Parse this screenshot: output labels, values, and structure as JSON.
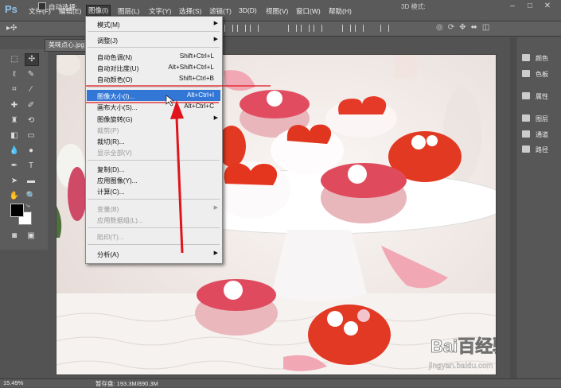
{
  "app": {
    "logo": "Ps"
  },
  "menubar": {
    "items": [
      "文件(F)",
      "编辑(E)",
      "图像(I)",
      "图层(L)",
      "文字(Y)",
      "选择(S)",
      "滤镜(T)",
      "3D(D)",
      "视图(V)",
      "窗口(W)",
      "帮助(H)"
    ],
    "controls": [
      "–",
      "□",
      "✕"
    ]
  },
  "options_bar": {
    "auto_select_label": "自动选择:",
    "mode_3d_label": "3D 模式:"
  },
  "document": {
    "tab_title": "美味点心.jpg"
  },
  "image_menu": {
    "items": [
      {
        "label": "模式(M)",
        "shortcut": "",
        "submenu": true,
        "disabled": false
      },
      {
        "label": "调整(J)",
        "shortcut": "",
        "submenu": true,
        "disabled": false
      },
      {
        "label": "自动色调(N)",
        "shortcut": "Shift+Ctrl+L",
        "submenu": false,
        "disabled": false
      },
      {
        "label": "自动对比度(U)",
        "shortcut": "Alt+Shift+Ctrl+L",
        "submenu": false,
        "disabled": false
      },
      {
        "label": "自动颜色(O)",
        "shortcut": "Shift+Ctrl+B",
        "submenu": false,
        "disabled": false
      },
      {
        "label": "图像大小(I)...",
        "shortcut": "Alt+Ctrl+I",
        "submenu": false,
        "disabled": false,
        "highlighted": true
      },
      {
        "label": "画布大小(S)...",
        "shortcut": "Alt+Ctrl+C",
        "submenu": false,
        "disabled": false
      },
      {
        "label": "图像旋转(G)",
        "shortcut": "",
        "submenu": true,
        "disabled": false
      },
      {
        "label": "裁剪(P)",
        "shortcut": "",
        "submenu": false,
        "disabled": true
      },
      {
        "label": "裁切(R)...",
        "shortcut": "",
        "submenu": false,
        "disabled": false
      },
      {
        "label": "显示全部(V)",
        "shortcut": "",
        "submenu": false,
        "disabled": true
      },
      {
        "label": "复制(D)...",
        "shortcut": "",
        "submenu": false,
        "disabled": false
      },
      {
        "label": "应用图像(Y)...",
        "shortcut": "",
        "submenu": false,
        "disabled": false
      },
      {
        "label": "计算(C)...",
        "shortcut": "",
        "submenu": false,
        "disabled": false
      },
      {
        "label": "变量(B)",
        "shortcut": "",
        "submenu": true,
        "disabled": true
      },
      {
        "label": "应用数据组(L)...",
        "shortcut": "",
        "submenu": false,
        "disabled": true
      },
      {
        "label": "陷印(T)...",
        "shortcut": "",
        "submenu": false,
        "disabled": true
      },
      {
        "label": "分析(A)",
        "shortcut": "",
        "submenu": true,
        "disabled": false
      }
    ]
  },
  "right_panel": {
    "items": [
      "颜色",
      "色板",
      "属性",
      "图层",
      "通道",
      "路径"
    ]
  },
  "status_bar": {
    "zoom": "15.49%",
    "info": "暂存盘: 193.3M/890.3M"
  },
  "watermark": {
    "brand": "Bai百经验",
    "url": "jingyan.baidu.com"
  },
  "colors": {
    "highlight": "#3377d6",
    "annotation": "#e0141b",
    "menu_bg": "#eeeeee"
  }
}
